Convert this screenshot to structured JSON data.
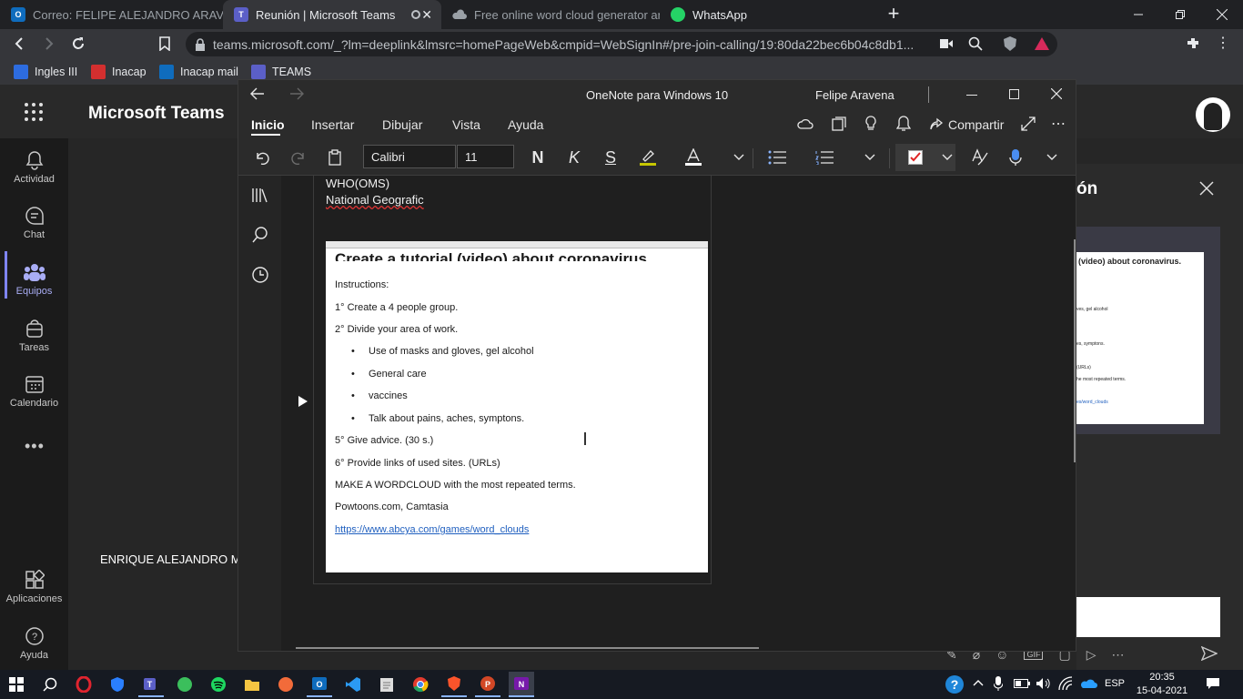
{
  "browser": {
    "tabs": [
      {
        "label": "Correo: FELIPE ALEJANDRO ARAVENA",
        "icon": "outlook-icon"
      },
      {
        "label": "Reunión | Microsoft Teams",
        "icon": "teams-icon"
      },
      {
        "label": "Free online word cloud generator and",
        "icon": "cloud-icon"
      },
      {
        "label": "WhatsApp",
        "icon": "whatsapp-icon"
      }
    ],
    "url": "teams.microsoft.com/_?lm=deeplink&lmsrc=homePageWeb&cmpid=WebSignIn#/pre-join-calling/19:80da22bec6b04c8db1...",
    "bookmarks": [
      "Ingles III",
      "Inacap",
      "Inacap mail",
      "TEAMS"
    ]
  },
  "teams": {
    "app_title": "Microsoft Teams",
    "rail": [
      "Actividad",
      "Chat",
      "Equipos",
      "Tareas",
      "Calendario",
      "Aplicaciones",
      "Ayuda"
    ],
    "participant": "ENRIQUE ALEJANDRO MA",
    "side_panel_title": "ón",
    "thumb_title": "(video) about coronavirus.",
    "thumb_lines": [
      "ves, gel  alcohol",
      "es, symptons.",
      "(URLs)",
      "he most repeated terms.",
      "es/word_clouds"
    ]
  },
  "onenote": {
    "window_title": "OneNote para Windows 10",
    "user": "Felipe Aravena",
    "menu": [
      "Inicio",
      "Insertar",
      "Dibujar",
      "Vista",
      "Ayuda"
    ],
    "share": "Compartir",
    "font": "Calibri",
    "size": "11",
    "bold": "N",
    "italic": "K",
    "strike": "S",
    "page_lines": [
      "WHO(OMS)",
      "National Geografic"
    ],
    "doc": {
      "title": "Create a tutorial (video) about coronavirus.",
      "instructions": "Instructions:",
      "l1": "1° Create a 4 people group.",
      "l2": "2° Divide your area of work.",
      "b1": "Use of masks and gloves, gel  alcohol",
      "b2": "General care",
      "b3": "vaccines",
      "b4": "Talk about pains, aches, symptons.",
      "l5": "5° Give advice. (30 s.)",
      "l6": "6° Provide links of used sites. (URLs)",
      "l7": "MAKE A WORDCLOUD with the most repeated terms.",
      "l8": "Powtoons.com, Camtasia",
      "link": "https://www.abcya.com/games/word_clouds"
    }
  },
  "taskbar": {
    "lang": "ESP",
    "time": "20:35",
    "date": "15-04-2021"
  }
}
